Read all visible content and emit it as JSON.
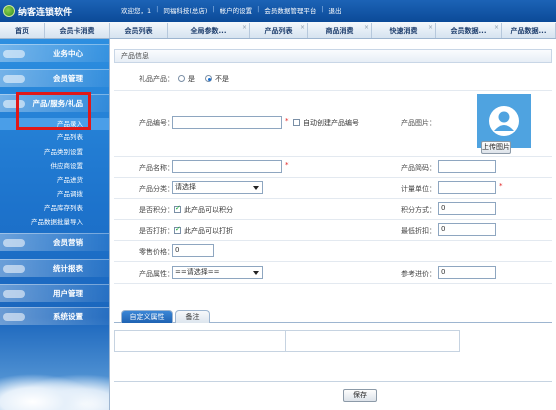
{
  "app": {
    "name": "纳客连锁软件"
  },
  "toplinks": [
    "欢迎您，1",
    "同福科技(总店)",
    "帐户的设置",
    "会员数据管理平台",
    "退出"
  ],
  "tabs": [
    {
      "label": "首页",
      "closable": false
    },
    {
      "label": "会员卡消费",
      "closable": false
    },
    {
      "label": "会员列表",
      "closable": false
    },
    {
      "label": "全局参数...",
      "closable": true
    },
    {
      "label": "产品列表",
      "closable": true
    },
    {
      "label": "商品消费",
      "closable": true
    },
    {
      "label": "快速消费",
      "closable": true
    },
    {
      "label": "会员数据...",
      "closable": true
    },
    {
      "label": "产品数据...",
      "closable": true
    }
  ],
  "sidebar": {
    "headers": [
      "业务中心",
      "会员管理",
      "产品/服务/礼品",
      "会员营销",
      "统计报表",
      "用户管理",
      "系统设置"
    ],
    "items": [
      "产品录入",
      "产品列表",
      "产品类别设置",
      "供应商设置",
      "产品进货",
      "产品调拨",
      "产品库存列表",
      "产品数据批量导入"
    ]
  },
  "form": {
    "title": "产品信息",
    "gift_label": "礼品产品：",
    "gift_yes": "是",
    "gift_no": "不是",
    "code_label": "产品编号：",
    "code_value": "",
    "auto_code": "自动创建产品编号",
    "image_label": "产品图片：",
    "upload_button": "上传图片",
    "name_label": "产品名称：",
    "name_value": "",
    "abbr_label": "产品简码：",
    "abbr_value": "",
    "category_label": "产品分类：",
    "category_value": "请选择",
    "unit_label": "计量单位：",
    "unit_value": "",
    "points_label": "是否积分：",
    "points_check": "此产品可以积分",
    "points_mode_label": "积分方式：",
    "points_mode_value": "0",
    "discount_label": "是否打折：",
    "discount_check": "此产品可以打折",
    "min_discount_label": "最低折扣：",
    "min_discount_value": "0",
    "price_label": "零售价格：",
    "price_value": "0",
    "attr_label": "产品属性：",
    "attr_value": "==请选择==",
    "ref_price_label": "参考进价：",
    "ref_price_value": "0"
  },
  "subtabs": [
    {
      "label": "自定义属性",
      "active": true
    },
    {
      "label": "备注",
      "active": false
    }
  ],
  "save_button": "保存",
  "colors": {
    "brand": "#1c63b6",
    "highlight": "#e01818",
    "required": "#e02020"
  }
}
